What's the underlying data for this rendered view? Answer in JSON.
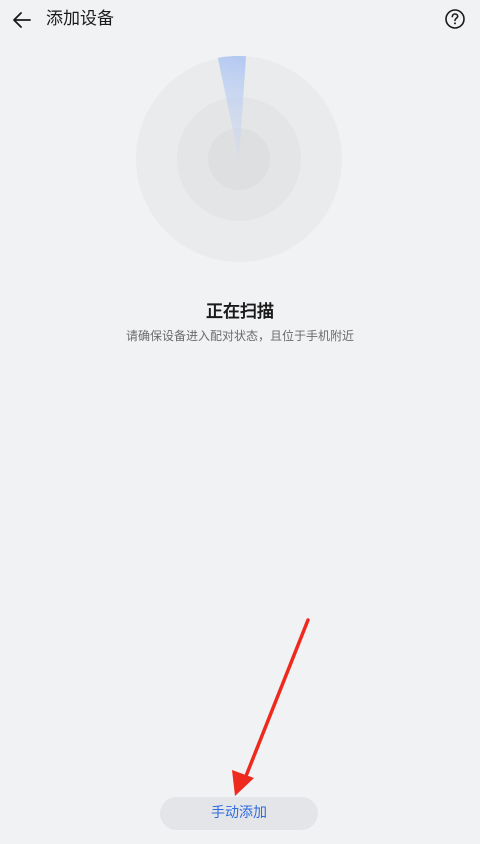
{
  "header": {
    "title": "添加设备",
    "back_icon": "arrow-left-icon",
    "help_icon": "question-circle-icon"
  },
  "scan": {
    "status": "正在扫描",
    "hint": "请确保设备进入配对状态，且位于手机附近"
  },
  "actions": {
    "manual_add_label": "手动添加"
  },
  "colors": {
    "background": "#f1f2f4",
    "accent": "#2f6be0",
    "annotation_arrow": "#ee2a1f"
  }
}
